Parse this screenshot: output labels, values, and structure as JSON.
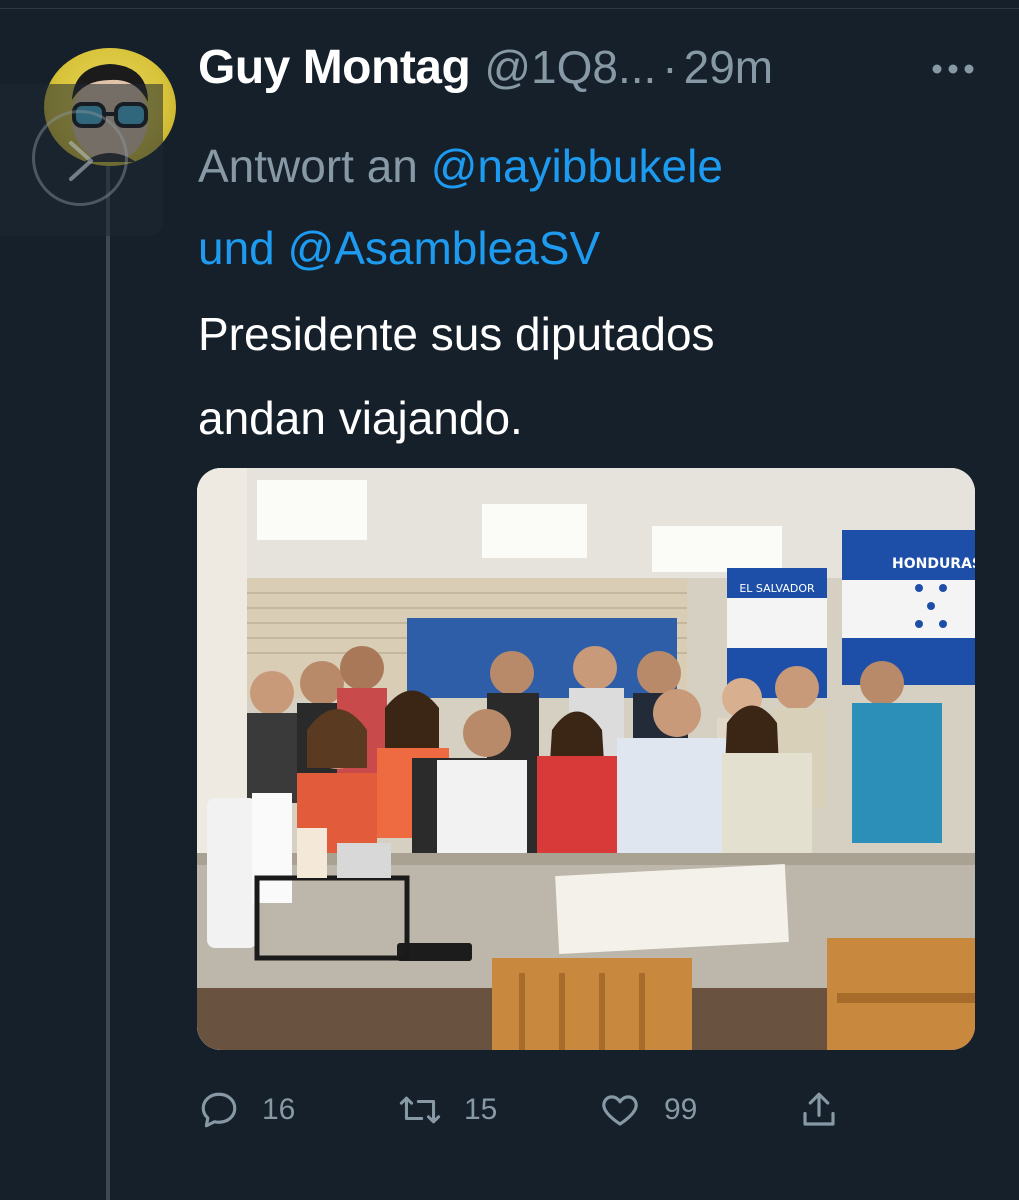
{
  "tweet": {
    "author_name": "Guy Montag",
    "author_handle": "@1Q8...",
    "separator": "·",
    "timestamp": "29m",
    "reply_prefix": "Antwort an",
    "reply_to_1": "@nayibbukele",
    "reply_conjunction": "und",
    "reply_to_2": "@AsambleaSV",
    "text_line_1": "Presidente sus diputados",
    "text_line_2": "andan viajando.",
    "photo": {
      "flag_label_1": "EL SALVADOR",
      "flag_label_2": "HONDURAS"
    }
  },
  "actions": {
    "reply_count": "16",
    "retweet_count": "15",
    "like_count": "99"
  },
  "colors": {
    "background": "#15202b",
    "accent": "#1d9bf0",
    "secondary_text": "#8899a6"
  }
}
